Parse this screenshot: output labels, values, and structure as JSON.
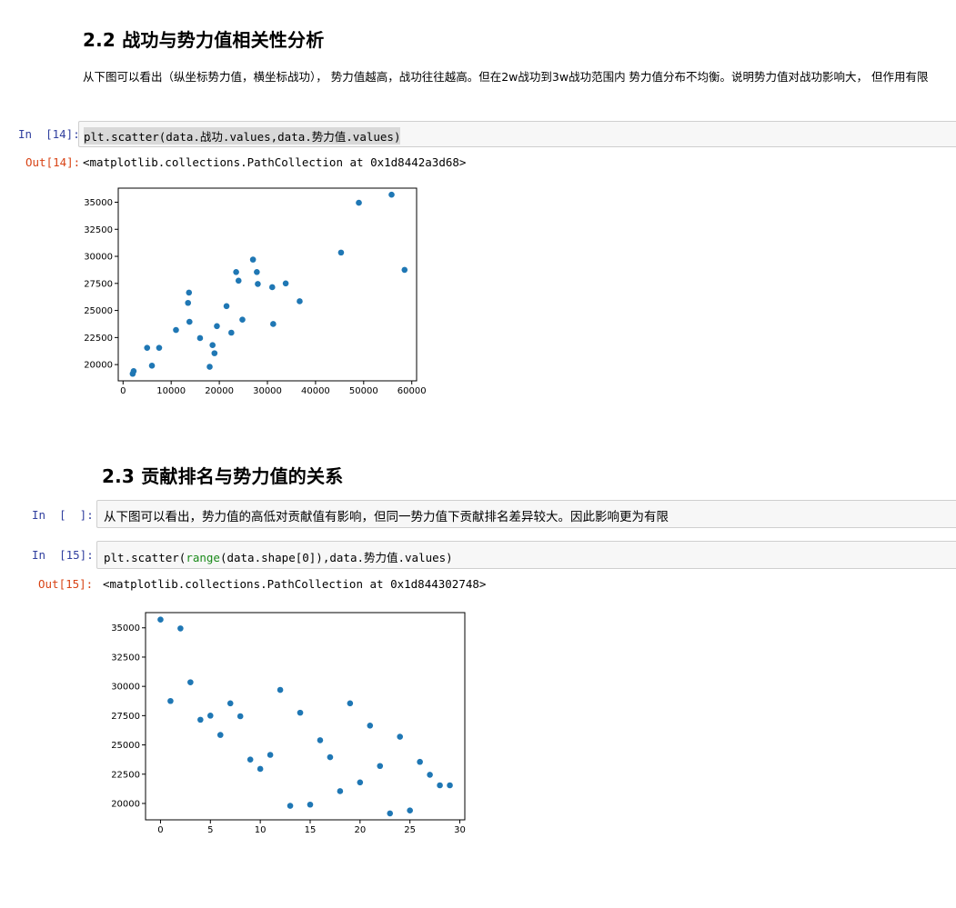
{
  "section22": {
    "heading": "2.2  战功与势力值相关性分析",
    "description": "从下图可以看出（纵坐标势力值，横坐标战功），  势力值越高，战功往往越高。但在2w战功到3w战功范围内 势力值分布不均衡。说明势力值对战功影响大， 但作用有限"
  },
  "cell14": {
    "in_prompt": "In  [14]:",
    "code": "plt.scatter(data.战功.values,data.势力值.values)",
    "out_prompt": "Out[14]:",
    "output": "<matplotlib.collections.PathCollection at 0x1d8442a3d68>"
  },
  "section23": {
    "heading": "2.3  贡献排名与势力值的关系"
  },
  "raw_cell": {
    "in_prompt": "In  [  ]:",
    "text": "从下图可以看出，势力值的高低对贡献值有影响，但同一势力值下贡献排名差异较大。因此影响更为有限"
  },
  "cell15": {
    "in_prompt": "In  [15]:",
    "code_prefix": "plt.scatter(",
    "code_builtin": "range",
    "code_suffix": "(data.shape[0]),data.势力值.values)",
    "out_prompt": "Out[15]:",
    "output": "<matplotlib.collections.PathCollection at 0x1d844302748>"
  },
  "colors": {
    "point": "#1f77b4",
    "in_prompt": "#303f9f",
    "out_prompt": "#d84315",
    "builtin": "#1a8a1a"
  },
  "chart_data": [
    {
      "type": "scatter",
      "xlim": [
        -1000,
        61000
      ],
      "ylim": [
        18500,
        36300
      ],
      "xticks": [
        0,
        10000,
        20000,
        30000,
        40000,
        50000,
        60000
      ],
      "yticks": [
        20000,
        22500,
        25000,
        27500,
        30000,
        32500,
        35000
      ],
      "grid": false,
      "points": [
        [
          2000,
          19150
        ],
        [
          2200,
          19400
        ],
        [
          5000,
          21550
        ],
        [
          6000,
          19900
        ],
        [
          7500,
          21550
        ],
        [
          11000,
          23200
        ],
        [
          13500,
          25700
        ],
        [
          13700,
          26650
        ],
        [
          13800,
          23950
        ],
        [
          16000,
          22450
        ],
        [
          18000,
          19800
        ],
        [
          18600,
          21800
        ],
        [
          19000,
          21050
        ],
        [
          19500,
          23550
        ],
        [
          21500,
          25400
        ],
        [
          22500,
          22950
        ],
        [
          23500,
          28550
        ],
        [
          24000,
          27750
        ],
        [
          24800,
          24150
        ],
        [
          27000,
          29700
        ],
        [
          27800,
          28550
        ],
        [
          28000,
          27450
        ],
        [
          31000,
          27150
        ],
        [
          31200,
          23750
        ],
        [
          33800,
          27500
        ],
        [
          36700,
          25850
        ],
        [
          45300,
          30350
        ],
        [
          49000,
          34950
        ],
        [
          55800,
          35700
        ],
        [
          58500,
          28750
        ]
      ]
    },
    {
      "type": "scatter",
      "xlim": [
        -1.5,
        30.5
      ],
      "ylim": [
        18600,
        36300
      ],
      "xticks": [
        0,
        5,
        10,
        15,
        20,
        25,
        30
      ],
      "yticks": [
        20000,
        22500,
        25000,
        27500,
        30000,
        32500,
        35000
      ],
      "grid": false,
      "points": [
        [
          0,
          35700
        ],
        [
          1,
          28750
        ],
        [
          2,
          34950
        ],
        [
          3,
          30350
        ],
        [
          4,
          27150
        ],
        [
          5,
          27500
        ],
        [
          6,
          25850
        ],
        [
          7,
          28550
        ],
        [
          8,
          27450
        ],
        [
          9,
          23750
        ],
        [
          10,
          22950
        ],
        [
          11,
          24150
        ],
        [
          12,
          29700
        ],
        [
          13,
          19800
        ],
        [
          14,
          27750
        ],
        [
          15,
          19900
        ],
        [
          16,
          25400
        ],
        [
          17,
          23950
        ],
        [
          18,
          21050
        ],
        [
          19,
          28550
        ],
        [
          20,
          21800
        ],
        [
          21,
          26650
        ],
        [
          22,
          23200
        ],
        [
          23,
          19150
        ],
        [
          24,
          25700
        ],
        [
          25,
          19400
        ],
        [
          26,
          23550
        ],
        [
          27,
          22450
        ],
        [
          28,
          21550
        ],
        [
          29,
          21550
        ]
      ]
    }
  ]
}
